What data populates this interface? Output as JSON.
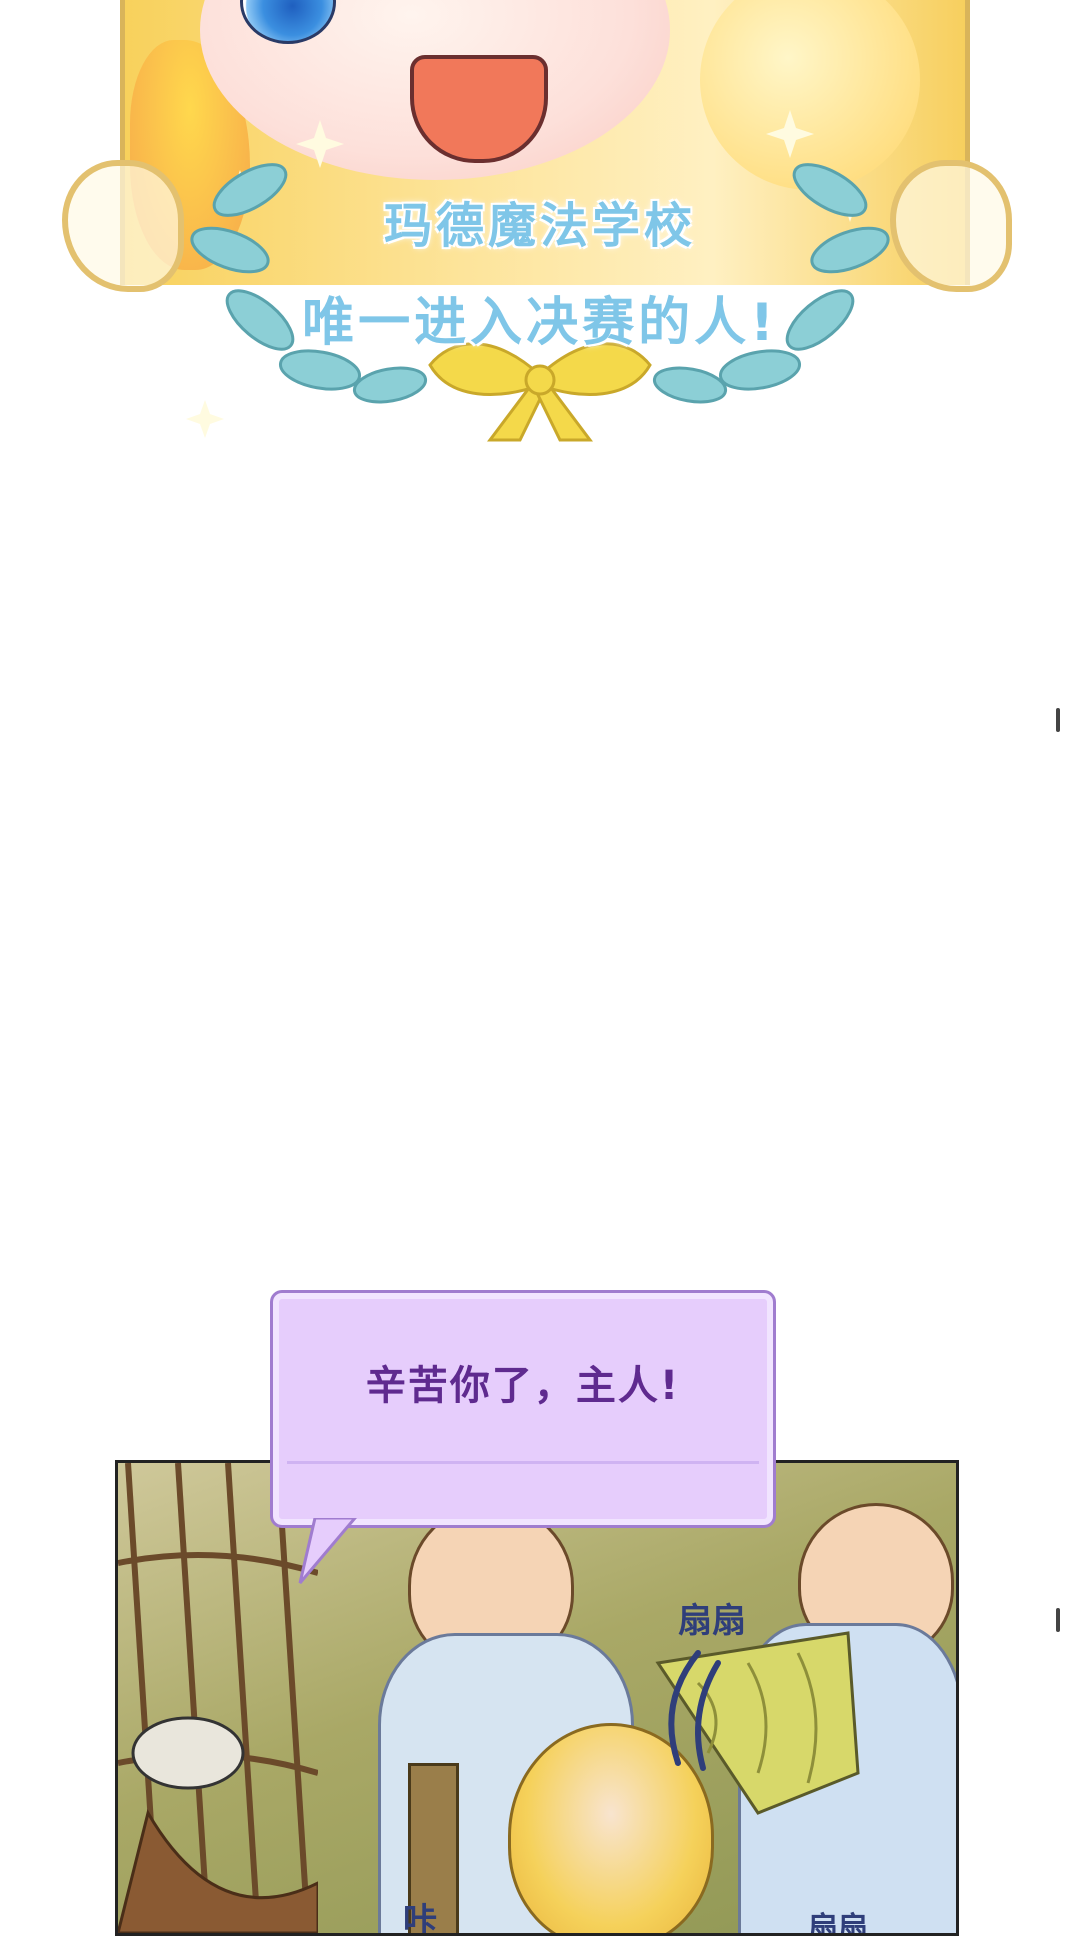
{
  "top_panel": {
    "title_line1": "玛德魔法学校",
    "title_line2": "唯一进入决赛的人!"
  },
  "comic_panel": {
    "speech": "辛苦你了，主人!",
    "sfx_fan": "扇扇",
    "sfx_sip": "咔",
    "sfx_fan2": "扇扇"
  },
  "colors": {
    "title_text": "#7fc6e8",
    "speech_bubble_fill": "#e6cdfc",
    "speech_text": "#5f2a8f",
    "ribbon": "#f4d94a",
    "leaf": "#8ccfd6"
  }
}
